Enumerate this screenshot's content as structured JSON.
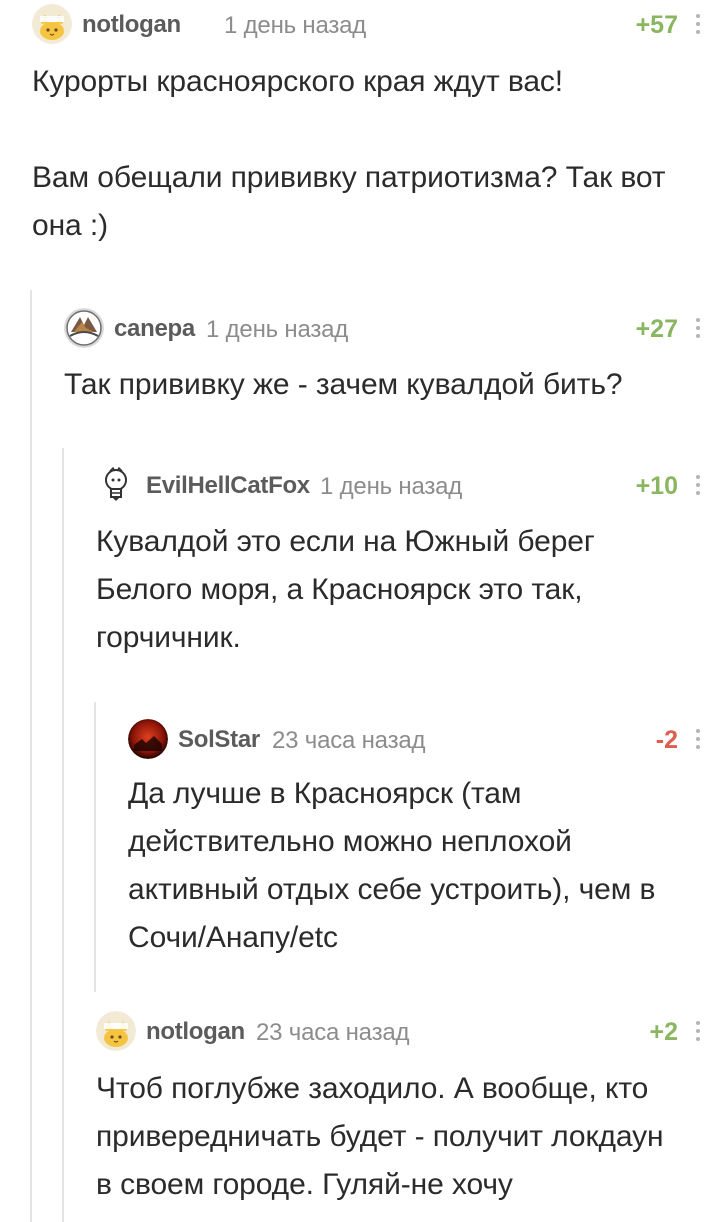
{
  "comments": [
    {
      "username": "notlogan",
      "time": "1 день назад",
      "rating": "+57",
      "avatar": "cat-avatar",
      "paragraphs": [
        "Курорты красноярского края ждут вас!",
        "Вам обещали прививку патриотизма? Так вот она :)"
      ]
    },
    {
      "username": "canepa",
      "time": "1 день назад",
      "rating": "+27",
      "avatar": "canepa-avatar",
      "paragraphs": [
        "Так прививку же - зачем кувалдой бить?"
      ]
    },
    {
      "username": "EvilHellCatFox",
      "time": "1 день назад",
      "rating": "+10",
      "avatar": "lightbulb-avatar",
      "paragraphs": [
        "Кувалдой это если на Южный берег Белого моря, а Красноярск это так, горчичник."
      ]
    },
    {
      "username": "SolStar",
      "time": "23 часа назад",
      "rating": "-2",
      "avatar": "red-moon-avatar",
      "paragraphs": [
        "Да лучше в Красноярск (там действительно можно неплохой активный отдых себе устроить), чем в Сочи/Анапу/etc"
      ]
    },
    {
      "username": "notlogan",
      "time": "23 часа назад",
      "rating": "+2",
      "avatar": "cat-avatar",
      "paragraphs": [
        "Чтоб поглубже заходило. А вообще, кто привередничать будет - получит локдаун в своем городе. Гуляй-не хочу"
      ]
    }
  ],
  "colors": {
    "positive_rating": "#8ab661",
    "negative_rating": "#dd5e4e",
    "username": "#5b5b5b",
    "meta": "#8c8c8c",
    "thread_line": "#e4e4e4"
  }
}
